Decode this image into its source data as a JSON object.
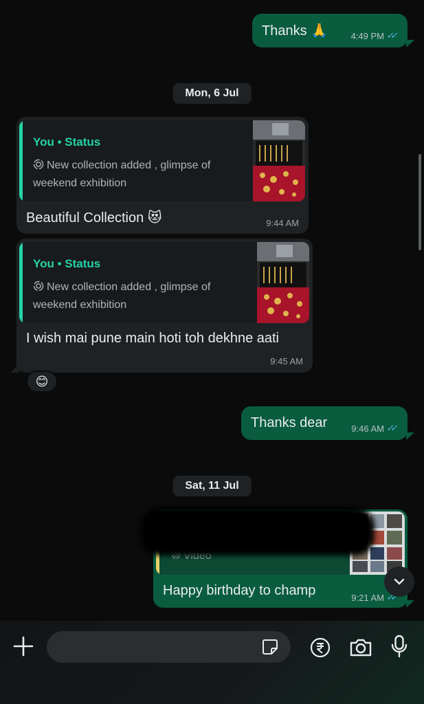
{
  "messages": {
    "m1": {
      "text": "Thanks 🙏",
      "time": "4:49 PM"
    },
    "date1": "Mon, 6 Jul",
    "m2": {
      "quote_title": "You • Status",
      "quote_line1": "New collection added , glimpse of",
      "quote_line2": "weekend exhibition",
      "text": "Beautiful Collection 😻",
      "time": "9:44 AM"
    },
    "m3": {
      "quote_title": "You • Status",
      "quote_line1": "New collection added , glimpse of",
      "quote_line2": "weekend exhibition",
      "text": "I wish mai pune main hoti toh dekhne aati",
      "time": "9:45 AM",
      "reaction": "😊"
    },
    "m4": {
      "text": "Thanks dear",
      "time": "9:46 AM"
    },
    "date2": "Sat, 11 Jul",
    "m5": {
      "quote_line": "Video",
      "text": "Happy birthday to champ",
      "time": "9:21 AM"
    }
  },
  "input": {
    "placeholder": ""
  },
  "icons": {
    "attach": "plus-icon",
    "sticker": "sticker-icon",
    "payment": "rupee-icon",
    "camera": "camera-icon",
    "mic": "microphone-icon",
    "scroll": "chevron-down-icon"
  },
  "colors": {
    "outgoing_bubble": "#0a5c3f",
    "incoming_bubble": "#1f2224",
    "accent": "#25d3a6",
    "read_ticks": "#53bdeb",
    "background": "#0b0b0b"
  }
}
